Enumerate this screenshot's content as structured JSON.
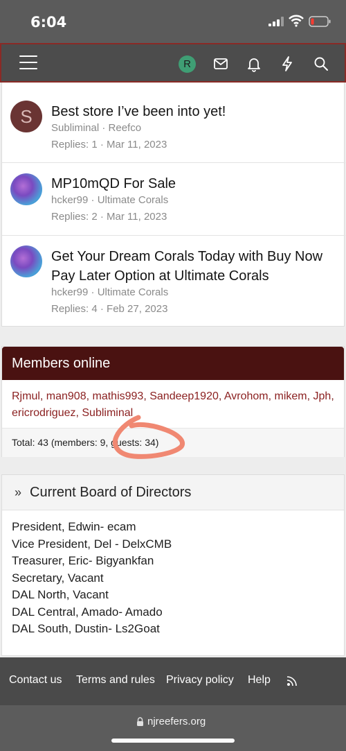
{
  "status": {
    "time": "6:04"
  },
  "nav": {
    "avatar_letter": "R"
  },
  "threads": [
    {
      "avatar_letter": "S",
      "title": "Best store I’ve been into yet!",
      "author_forum": "Subliminal · Reefco",
      "replies_date": "Replies: 1 · Mar 11, 2023"
    },
    {
      "title": "MP10mQD For Sale",
      "author_forum": "hcker99 · Ultimate Corals",
      "replies_date": "Replies: 2 · Mar 11, 2023"
    },
    {
      "title": "Get Your Dream Corals Today with Buy Now Pay Later Option at Ultimate Corals",
      "author_forum": "hcker99 · Ultimate Corals",
      "replies_date": "Replies: 4 · Feb 27, 2023"
    }
  ],
  "members_online": {
    "heading": "Members online",
    "names": [
      "Rjmul",
      "man908",
      "mathis993",
      "Sandeep1920",
      "Avrohom",
      "mikem",
      "Jph",
      "ericrodriguez",
      "Subliminal"
    ],
    "total": "Total: 43 (members: 9, guests: 34)"
  },
  "board": {
    "heading": "Current Board of Directors",
    "lines": [
      "President, Edwin- ecam",
      "Vice President, Del - DelxCMB",
      "Treasurer, Eric- Bigyankfan",
      "Secretary, Vacant",
      "DAL North, Vacant",
      "DAL Central, Amado- Amado",
      "DAL South, Dustin- Ls2Goat"
    ]
  },
  "footer": {
    "contact": "Contact us",
    "terms": "Terms and rules",
    "privacy": "Privacy policy",
    "help": "Help"
  },
  "browser": {
    "url": "njreefers.org"
  },
  "colors": {
    "members_header": "#4a1211",
    "member_link": "#8a1f1f",
    "nav_bg": "#4c4c4c",
    "avatar_green": "#3f9e74"
  }
}
